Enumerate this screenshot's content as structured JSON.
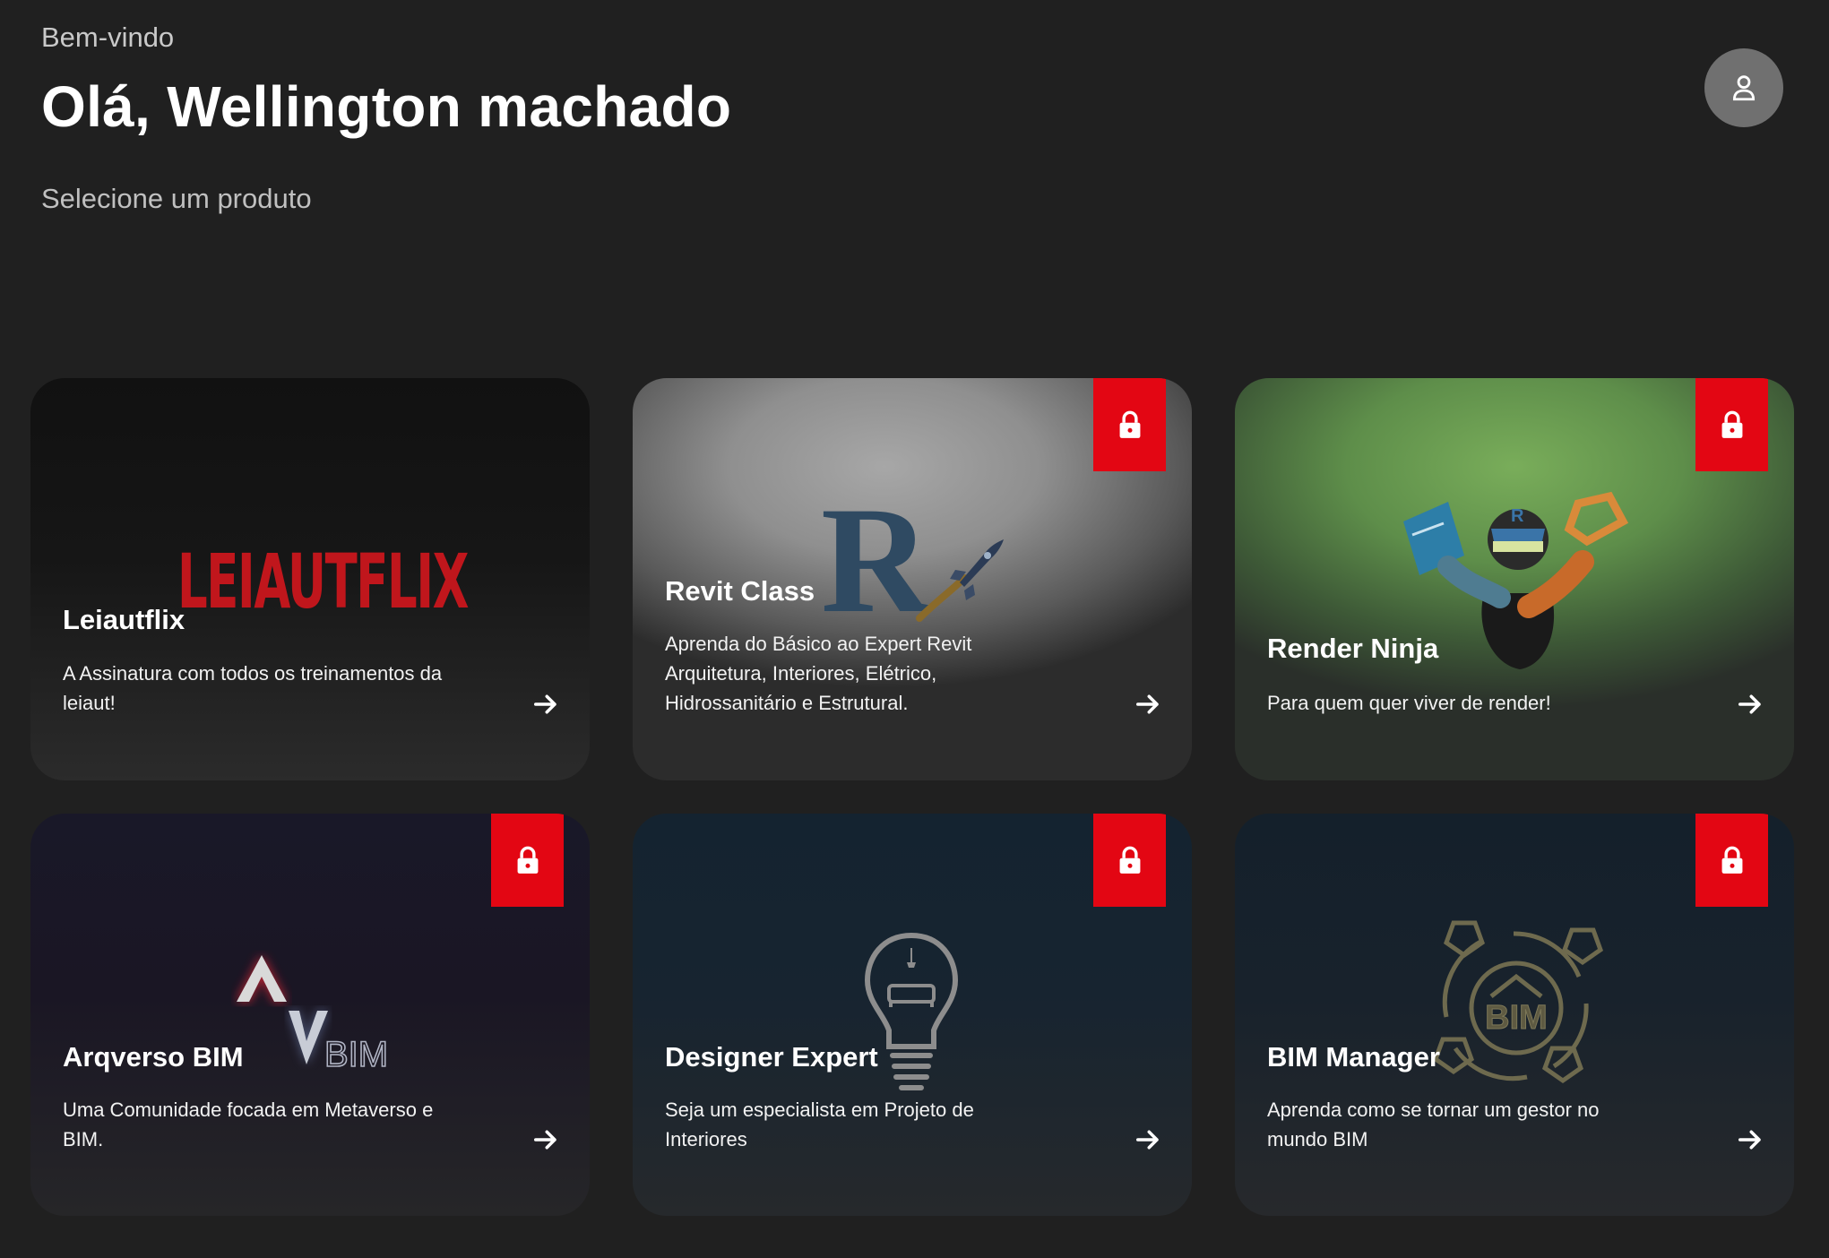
{
  "header": {
    "welcome": "Bem-vindo",
    "greeting": "Olá, Wellington machado",
    "subtitle": "Selecione um produto"
  },
  "user_icon": "user-icon",
  "colors": {
    "background": "#202020",
    "lock": "#e30613",
    "leiautflix_brand": "#c0161c"
  },
  "products": [
    {
      "title": "Leiautflix",
      "description": "A Assinatura com todos os treinamentos da leiaut!",
      "logo_text": "LEIAUTFLIX",
      "locked": false
    },
    {
      "title": "Revit Class",
      "description": "Aprenda do Básico ao Expert Revit Arquitetura, Interiores, Elétrico, Hidrossanitário e Estrutural.",
      "logo_text": "R",
      "locked": true
    },
    {
      "title": "Render Ninja",
      "description": "Para quem quer viver de render!",
      "logo_text": "R",
      "locked": true
    },
    {
      "title": "Arqverso BIM",
      "description": "Uma Comunidade focada em Metaverso e BIM.",
      "logo_text": "BIM",
      "locked": true
    },
    {
      "title": "Designer Expert",
      "description": "Seja um especialista em Projeto de Interiores",
      "logo_text": "",
      "locked": true
    },
    {
      "title": "BIM Manager",
      "description": "Aprenda como se tornar um gestor no mundo BIM",
      "logo_text": "BIM",
      "locked": true
    }
  ]
}
